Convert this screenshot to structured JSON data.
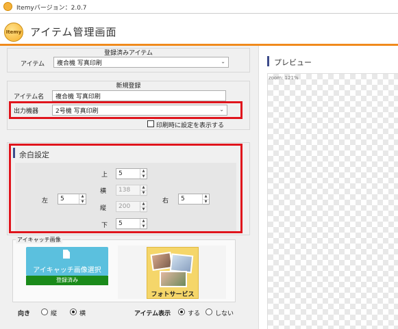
{
  "window": {
    "title": "Itemyバージョン：2.0.7"
  },
  "header": {
    "logo_text": "Itemy",
    "title": "アイテム管理画面"
  },
  "registered": {
    "group_title": "登録済みアイテム",
    "item_label": "アイテム",
    "item_value": "複合機  写真印刷"
  },
  "new_registration": {
    "group_title": "新規登録",
    "name_label": "アイテム名",
    "name_value": "複合機  写真印刷",
    "device_label": "出力機器",
    "device_value": "2号機  写真印刷",
    "print_setting_checkbox": "印刷時に設定を表示する"
  },
  "margins": {
    "title": "余白設定",
    "top_label": "上",
    "top_value": "5",
    "width_label": "横",
    "width_value": "138",
    "height_label": "縦",
    "height_value": "200",
    "bottom_label": "下",
    "bottom_value": "5",
    "left_label": "左",
    "left_value": "5",
    "right_label": "右",
    "right_value": "5"
  },
  "eyecatch": {
    "title": "アイキャッチ画像",
    "button_label": "アイキャッチ画像選択",
    "status": "登録済み",
    "thumbnail_caption": "フォトサービス"
  },
  "orientation": {
    "label": "向き",
    "options": [
      "縦",
      "横"
    ],
    "selected": "横"
  },
  "item_display": {
    "label": "アイテム表示",
    "options": [
      "する",
      "しない"
    ],
    "selected": "する"
  },
  "preview": {
    "title": "プレビュー",
    "zoom": "zoom: 121%"
  },
  "colors": {
    "accent": "#f08a1c",
    "highlight": "#e0141c",
    "button": "#5bc0de",
    "status": "#1a8a1a"
  }
}
